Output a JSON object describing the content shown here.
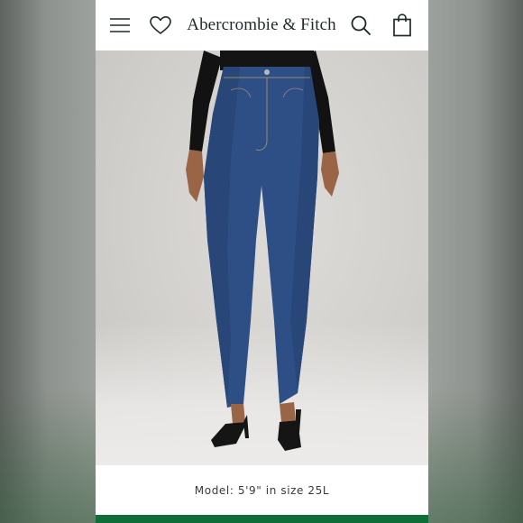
{
  "header": {
    "brand": "Abercrombie & Fitch",
    "icons": [
      "hamburger-menu-icon",
      "heart-icon",
      "search-icon",
      "shopping-bag-icon"
    ]
  },
  "product_image": {
    "subject": "high-rise straight jeans",
    "denim_color": "#2e4f86"
  },
  "caption": {
    "text": "Model: 5'9\" in size 25L"
  },
  "colors": {
    "brand_text": "#1f2a2a",
    "footer_accent": "#0f6e38",
    "background": "#9da19d"
  }
}
